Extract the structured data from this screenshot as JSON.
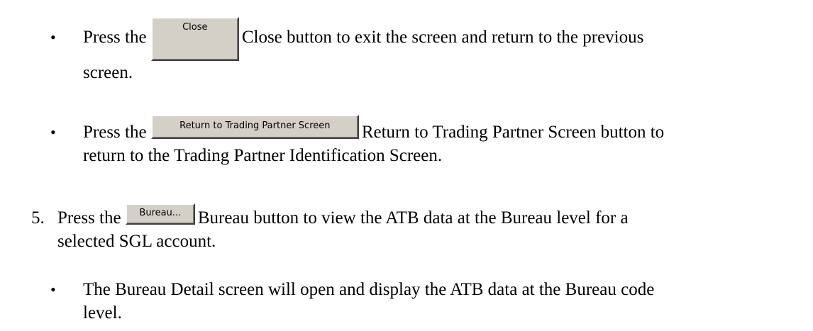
{
  "items": [
    {
      "marker": "•",
      "prefix": "Press the",
      "button_label": "Close",
      "line1_suffix": "Close button to exit the screen and return to the previous",
      "line2": "screen."
    },
    {
      "marker": "•",
      "prefix": "Press the",
      "button_label": "Return to Trading Partner Screen",
      "line1_suffix": "Return to Trading Partner Screen button to",
      "line2": "return to the Trading Partner Identification Screen."
    },
    {
      "marker": "5.",
      "prefix": "Press the",
      "button_label": "Bureau...",
      "line1_suffix": "Bureau button to view the ATB data at the Bureau level for a",
      "line2": "selected SGL account."
    },
    {
      "marker": "•",
      "line1": "The Bureau Detail screen will open and display the ATB data at the Bureau code",
      "line2": "level."
    }
  ]
}
